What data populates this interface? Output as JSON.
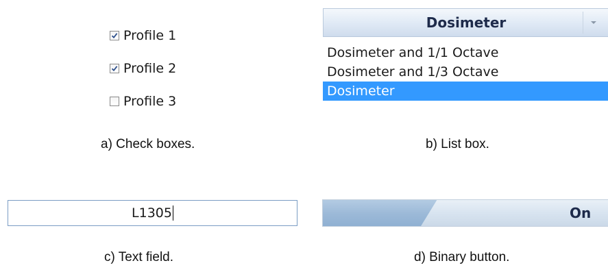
{
  "checkboxes": {
    "items": [
      {
        "label": "Profile 1",
        "checked": true
      },
      {
        "label": "Profile 2",
        "checked": true
      },
      {
        "label": "Profile 3",
        "checked": false
      }
    ],
    "caption": "a) Check boxes."
  },
  "listbox": {
    "selected_value": "Dosimeter",
    "options": [
      "Dosimeter and 1/1 Octave",
      "Dosimeter and 1/3 Octave",
      "Dosimeter"
    ],
    "caption": "b) List box."
  },
  "textfield": {
    "value": "L1305",
    "caption": "c) Text field."
  },
  "binary_button": {
    "label": "On",
    "fill_fraction": 0.4,
    "caption": "d) Binary button."
  },
  "colors": {
    "selection": "#3399ff",
    "header_text": "#1d2a4a",
    "check_mark": "#2c4e8a"
  }
}
